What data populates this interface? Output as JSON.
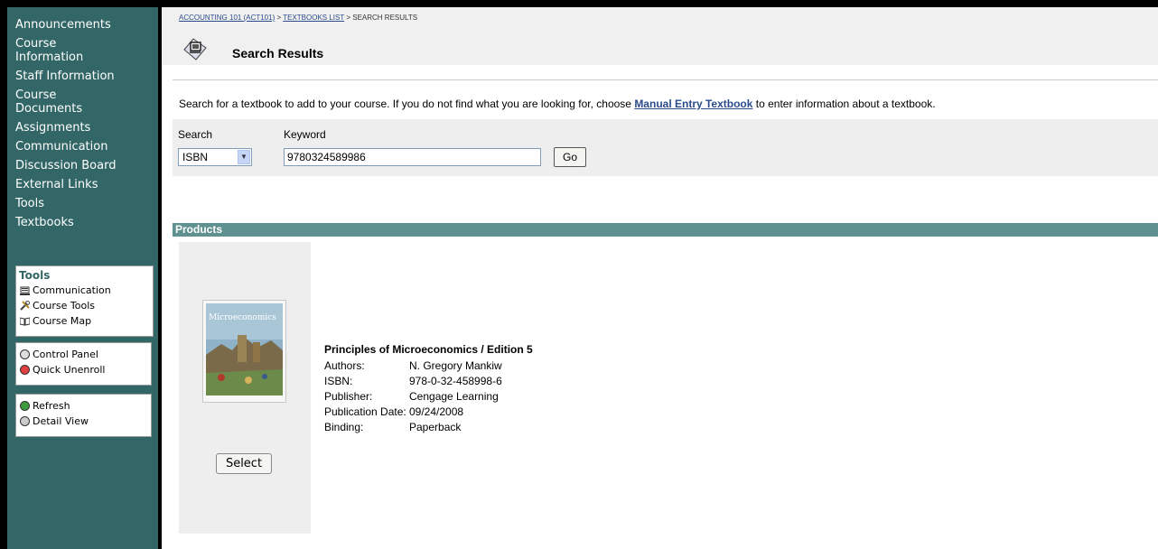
{
  "nav": {
    "items": [
      {
        "label": "Announcements"
      },
      {
        "label": "Course Information"
      },
      {
        "label": "Staff Information"
      },
      {
        "label": "Course Documents"
      },
      {
        "label": "Assignments"
      },
      {
        "label": "Communication"
      },
      {
        "label": "Discussion Board"
      },
      {
        "label": "External Links"
      },
      {
        "label": "Tools"
      },
      {
        "label": "Textbooks"
      }
    ],
    "tools_header": "Tools",
    "tools": [
      {
        "label": "Communication",
        "icon": "communication-icon"
      },
      {
        "label": "Course Tools",
        "icon": "course-tools-icon"
      },
      {
        "label": "Course Map",
        "icon": "course-map-icon"
      }
    ],
    "panel_tools": [
      {
        "label": "Control Panel",
        "icon": "control-panel-icon"
      },
      {
        "label": "Quick Unenroll",
        "icon": "quick-unenroll-icon"
      }
    ],
    "view_tools": [
      {
        "label": "Refresh",
        "icon": "refresh-icon"
      },
      {
        "label": "Detail View",
        "icon": "detail-view-icon"
      }
    ]
  },
  "breadcrumb": {
    "course": "ACCOUNTING 101 (ACT101)",
    "sep1": " > ",
    "list": "TEXTBOOKS LIST",
    "sep2": " > ",
    "current": "SEARCH RESULTS"
  },
  "page_title": "Search Results",
  "intro": {
    "before": "Search for a textbook to add to your course. If you do not find what you are looking for, choose ",
    "link": "Manual Entry Textbook",
    "after": " to enter information about a textbook."
  },
  "search": {
    "search_label": "Search",
    "keyword_label": "Keyword",
    "selected": "ISBN",
    "keyword_value": "9780324589986",
    "go_label": "Go"
  },
  "products": {
    "header": "Products",
    "select_label": "Select",
    "cover_title": "Microeconomics",
    "item": {
      "title": "Principles of Microeconomics / Edition 5",
      "fields": [
        {
          "key": "Authors:",
          "value": "N. Gregory Mankiw"
        },
        {
          "key": "ISBN:",
          "value": "978-0-32-458998-6"
        },
        {
          "key": "Publisher:",
          "value": "Cengage Learning"
        },
        {
          "key": "Publication Date:",
          "value": "09/24/2008"
        },
        {
          "key": "Binding:",
          "value": "Paperback"
        }
      ]
    }
  },
  "colors": {
    "nav_bg": "#336666",
    "products_bar": "#5f9190",
    "link": "#2b4b8c"
  }
}
